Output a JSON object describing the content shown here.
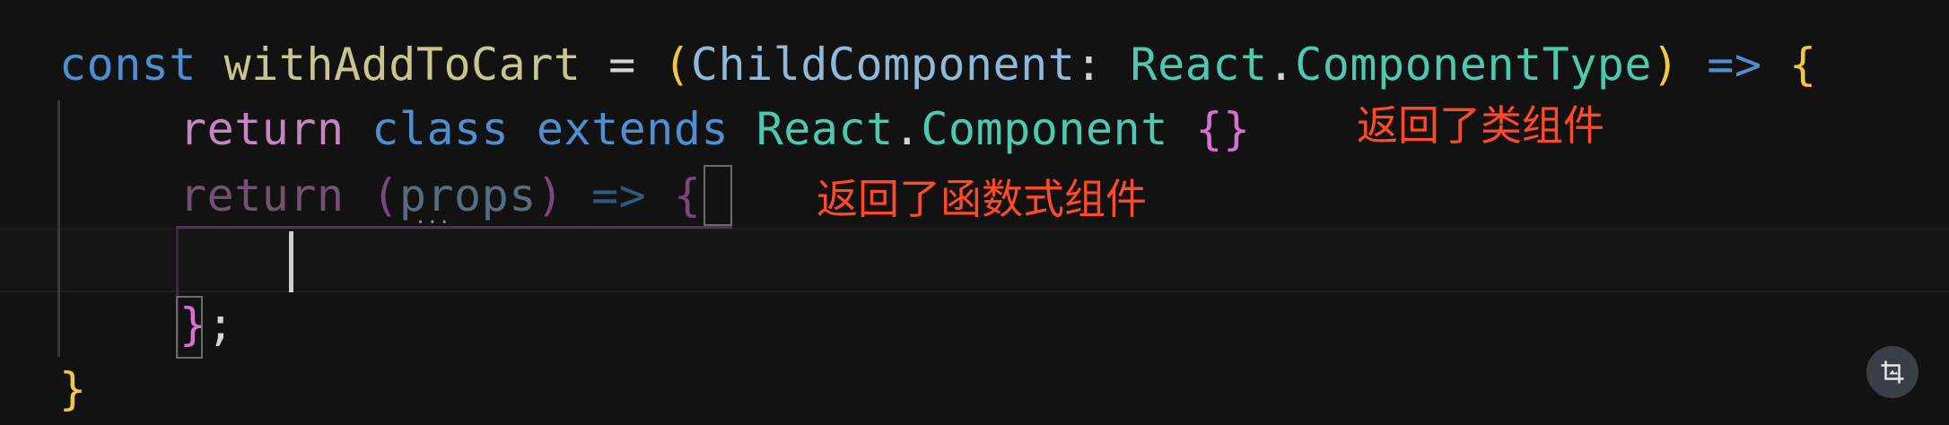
{
  "code": {
    "line1": {
      "const": "const",
      "name": "withAddToCart",
      "eq": " = ",
      "lparen": "(",
      "param": "ChildComponent",
      "colon": ": ",
      "react": "React",
      "dot": ".",
      "type": "ComponentType",
      "rparen": ")",
      "arrow": " => ",
      "lbrace": "{"
    },
    "line2": {
      "return": "return",
      "class": "class",
      "extends": "extends",
      "react": "React",
      "dot": ".",
      "component": "Component",
      "braces": "{}"
    },
    "line3": {
      "return": "return",
      "lparen": "(",
      "param": "props",
      "rparen": ")",
      "arrow": "=>",
      "lbrace": "{"
    },
    "line5": {
      "rbrace": "}",
      "semi": ";"
    },
    "line6": {
      "rbrace": "}"
    },
    "dots": "..."
  },
  "annotations": {
    "class_component": "返回了类组件",
    "function_component": "返回了函数式组件"
  },
  "controls": {
    "crop_icon": "crop-icon"
  },
  "colors": {
    "annotation": "#ff4a2a",
    "background": "#121212"
  }
}
